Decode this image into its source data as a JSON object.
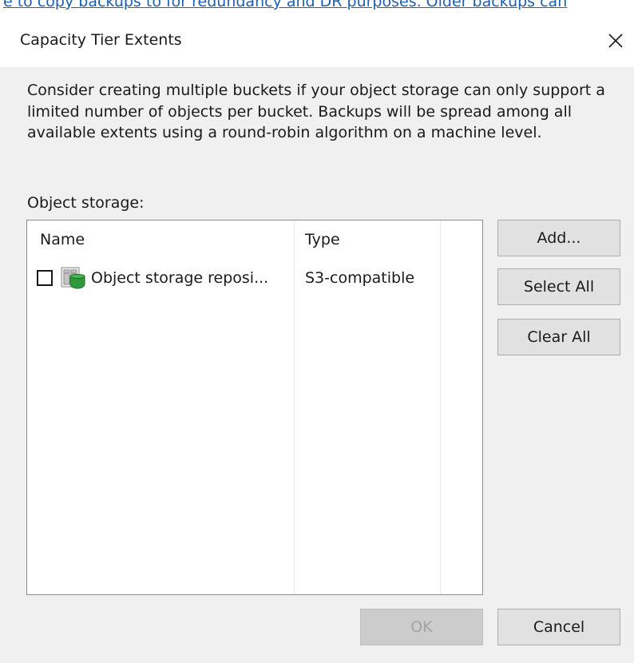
{
  "background": {
    "partial_text": "e to copy backups to for redundancy and DR purposes. Older backups can"
  },
  "dialog": {
    "title": "Capacity Tier Extents",
    "close_glyph": "close-icon",
    "description": "Consider creating multiple buckets if your object storage can only support a limited number of objects per bucket. Backups will be spread among all available extents using a round-robin algorithm on a machine level.",
    "storage_label": "Object storage:"
  },
  "list": {
    "columns": [
      "Name",
      "Type"
    ],
    "rows": [
      {
        "checked": false,
        "icon": "object-storage-repository-icon",
        "name": "Object storage reposi...",
        "type": "S3-compatible"
      }
    ]
  },
  "buttons": {
    "add": "Add...",
    "select_all": "Select All",
    "clear_all": "Clear All",
    "ok": "OK",
    "cancel": "Cancel"
  },
  "colors": {
    "dialog_bg": "#f0f0f0",
    "link_blue": "#1e5fb4",
    "icon_green": "#2f9a3c"
  }
}
